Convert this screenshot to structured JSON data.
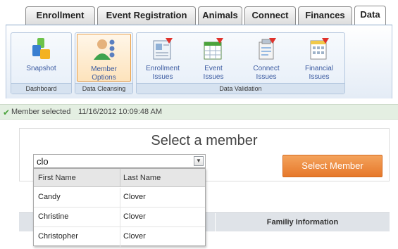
{
  "tabs": [
    {
      "label": "Enrollment",
      "active": false
    },
    {
      "label": "Event Registration",
      "active": false
    },
    {
      "label": "Animals",
      "active": false
    },
    {
      "label": "Connect",
      "active": false
    },
    {
      "label": "Finances",
      "active": false
    },
    {
      "label": "Data",
      "active": true
    }
  ],
  "ribbon": {
    "groups": [
      {
        "label": "Dashboard",
        "buttons": [
          {
            "label_line1": "Snapshot",
            "label_line2": "",
            "icon": "snapshot-icon"
          }
        ]
      },
      {
        "label": "Data Cleansing",
        "buttons": [
          {
            "label_line1": "Member",
            "label_line2": "Options",
            "icon": "member-options-icon",
            "selected": true
          }
        ]
      },
      {
        "label": "Data Validation",
        "buttons": [
          {
            "label_line1": "Enrollment",
            "label_line2": "Issues",
            "icon": "enrollment-issues-icon"
          },
          {
            "label_line1": "Event",
            "label_line2": "Issues",
            "icon": "event-issues-icon"
          },
          {
            "label_line1": "Connect",
            "label_line2": "Issues",
            "icon": "connect-issues-icon"
          },
          {
            "label_line1": "Financial",
            "label_line2": "Issues",
            "icon": "financial-issues-icon"
          }
        ]
      }
    ]
  },
  "status": {
    "message": "Member selected",
    "timestamp": "11/16/2012 10:09:48 AM",
    "accent": "#4aa33b"
  },
  "panel": {
    "title": "Select a member",
    "select_button": "Select Member",
    "button_color": "#e6782a"
  },
  "combo": {
    "value": "clo"
  },
  "dropdown": {
    "columns": [
      "First Name",
      "Last Name"
    ],
    "rows": [
      [
        "Candy",
        "Clover"
      ],
      [
        "Christine",
        "Clover"
      ],
      [
        "Christopher",
        "Clover"
      ]
    ]
  },
  "grid": {
    "family_header": "Familiy Information"
  }
}
